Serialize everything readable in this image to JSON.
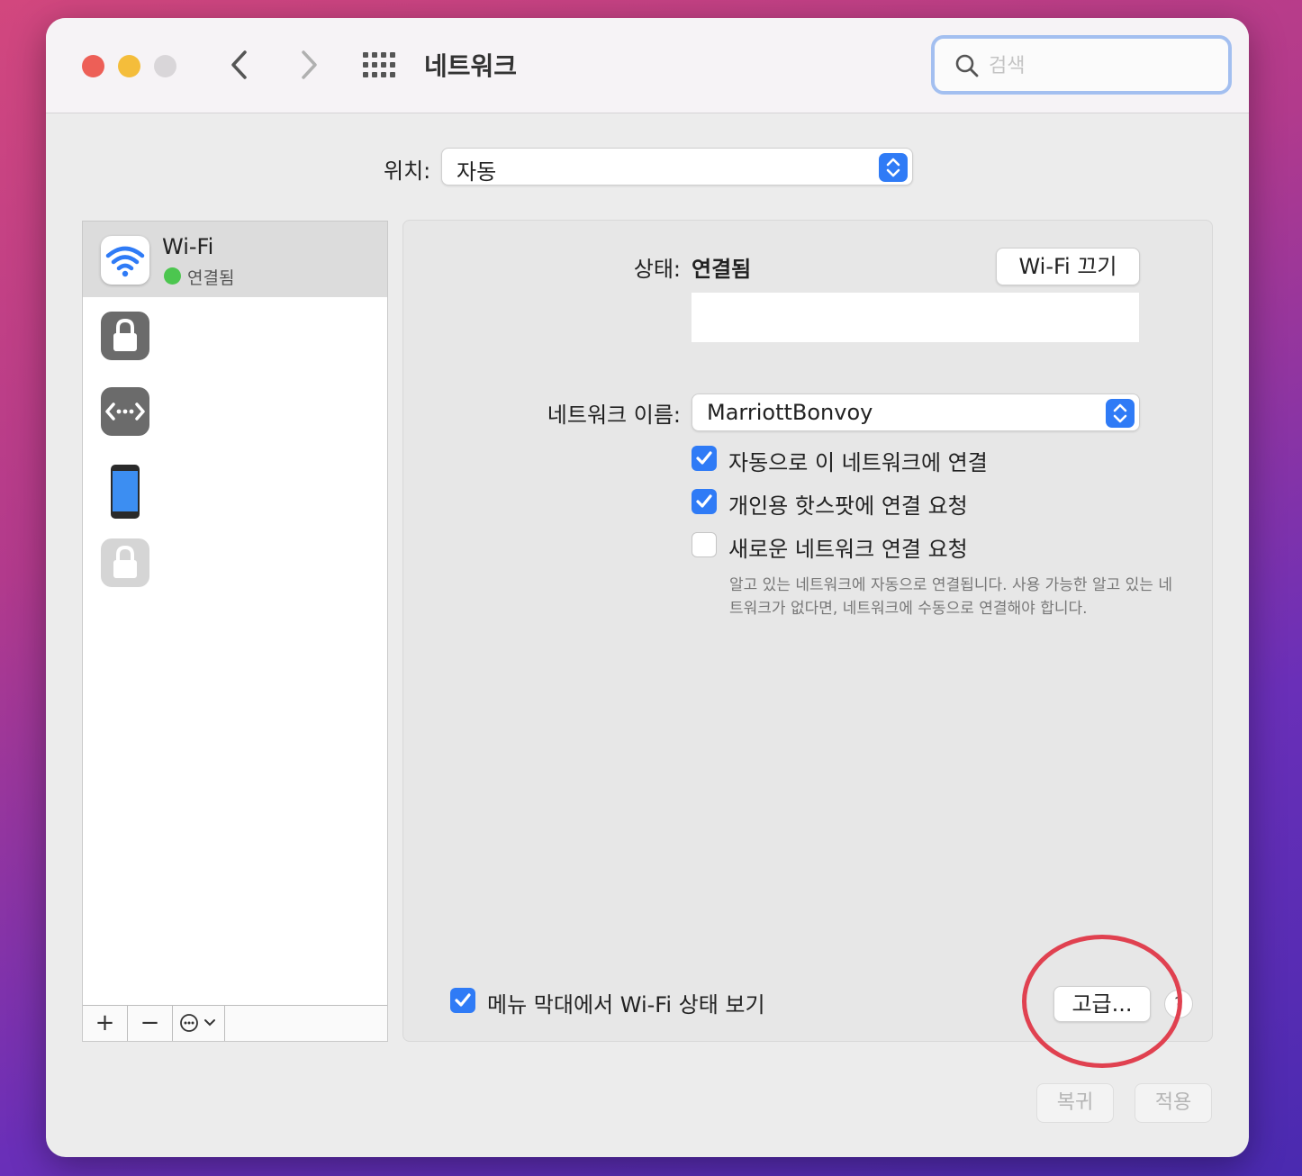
{
  "window": {
    "title": "네트워크",
    "search_placeholder": "검색"
  },
  "location": {
    "label": "위치:",
    "value": "자동"
  },
  "sidebar": {
    "services": [
      {
        "name": "Wi-Fi",
        "status": "연결됨",
        "icon": "wifi-icon",
        "selected": true
      },
      {
        "name": "",
        "status": "",
        "icon": "lock-icon"
      },
      {
        "name": "",
        "status": "",
        "icon": "ethernet-icon"
      },
      {
        "name": "",
        "status": "",
        "icon": "iphone-icon"
      },
      {
        "name": "",
        "status": "",
        "icon": "lock-disabled-icon"
      }
    ],
    "toolbar": {
      "add": "+",
      "remove": "−",
      "more": "⋯"
    }
  },
  "panel": {
    "status_label": "상태:",
    "status_value": "연결됨",
    "wifi_off_button": "Wi-Fi 끄기",
    "network_name_label": "네트워크 이름:",
    "network_name_value": "MarriottBonvoy",
    "checkboxes": [
      {
        "label": "자동으로 이 네트워크에 연결",
        "checked": true
      },
      {
        "label": "개인용 핫스팟에 연결 요청",
        "checked": true
      },
      {
        "label": "새로운 네트워크 연결 요청",
        "checked": false
      }
    ],
    "hint_text": "알고 있는 네트워크에 자동으로 연결됩니다. 사용 가능한 알고 있는 네트워크가 없다면, 네트워크에 수동으로 연결해야 합니다.",
    "menubar_checkbox": {
      "label": "메뉴 막대에서 Wi-Fi 상태 보기",
      "checked": true
    },
    "advanced_button": "고급...",
    "help_button": "?"
  },
  "footer": {
    "revert_button": "복귀",
    "apply_button": "적용"
  },
  "colors": {
    "accent": "#2f7bf6",
    "connected": "#4cc64f",
    "annotation": "#e04150"
  }
}
